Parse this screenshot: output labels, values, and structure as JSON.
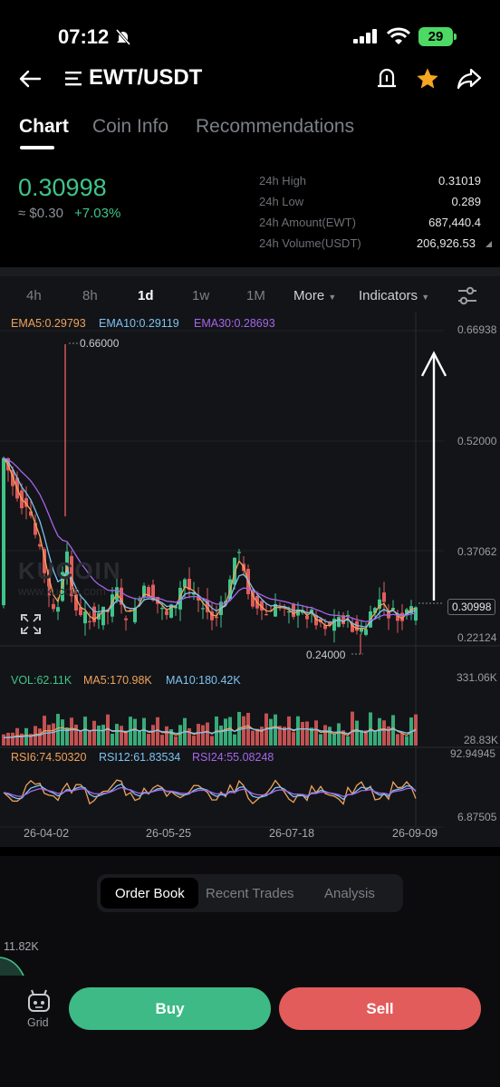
{
  "status_bar": {
    "time": "07:12",
    "battery": "29"
  },
  "header": {
    "pair": "EWT/USDT"
  },
  "tabs": [
    "Chart",
    "Coin Info",
    "Recommendations"
  ],
  "price": {
    "last": "0.30998",
    "fiat": "≈ $0.30",
    "change": "+7.03%",
    "stats": [
      {
        "label": "24h High",
        "value": "0.31019"
      },
      {
        "label": "24h Low",
        "value": "0.289"
      },
      {
        "label": "24h Amount(EWT)",
        "value": "687,440.4"
      },
      {
        "label": "24h Volume(USDT)",
        "value": "206,926.53"
      }
    ]
  },
  "timeframes": [
    "4h",
    "8h",
    "1d",
    "1w",
    "1M"
  ],
  "dropdowns": {
    "more": "More",
    "indicators": "Indicators"
  },
  "chart": {
    "ema5": "EMA5:0.29793",
    "ema10": "EMA10:0.29119",
    "ema30": "EMA30:0.28693",
    "vol": "VOL:62.11K",
    "ma5": "MA5:170.98K",
    "ma10": "MA10:180.42K",
    "rsi6": "RSI6:74.50320",
    "rsi12": "RSI12:61.83534",
    "rsi24": "RSI24:55.08248",
    "price_axis": [
      "0.66938",
      "0.52000",
      "0.37062",
      "0.22124"
    ],
    "current_price_tag": "0.30998",
    "high_marker": "0.66000",
    "low_marker": "0.24000",
    "vol_axis": [
      "331.06K",
      "28.83K"
    ],
    "rsi_axis": [
      "92.94945",
      "6.87505"
    ],
    "dates": [
      "26-04-02",
      "26-05-25",
      "26-07-18",
      "26-09-09"
    ],
    "watermark": "KUCOIN",
    "watermark_url": "www.kucoin.com",
    "colors": {
      "up": "#3fc48a",
      "down": "#e25c5c",
      "ema5": "#f0a35a",
      "ema10": "#7cc3f0",
      "ema30": "#a566e8"
    }
  },
  "bottom_tabs": [
    "Order Book",
    "Recent Trades",
    "Analysis"
  ],
  "depth_value": "11.82K",
  "grid_label": "Grid",
  "actions": {
    "buy": "Buy",
    "sell": "Sell"
  }
}
